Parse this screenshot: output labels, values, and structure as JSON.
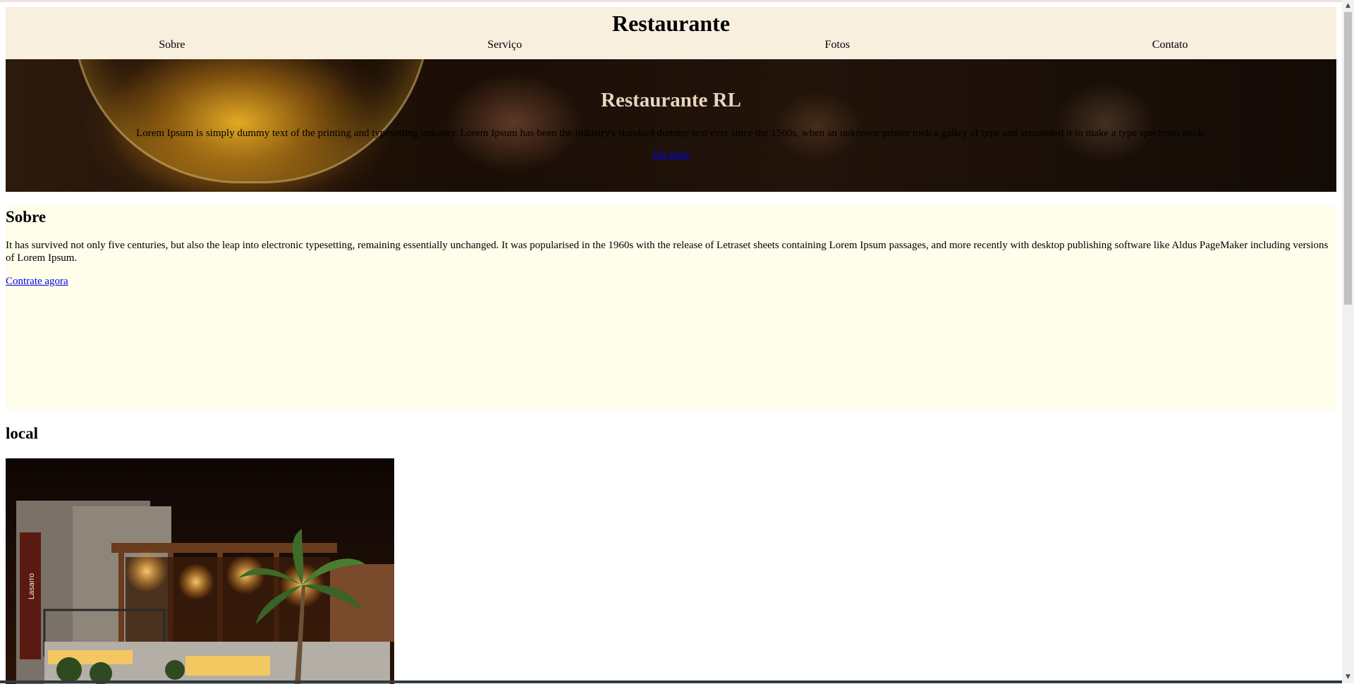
{
  "header": {
    "title": "Restaurante"
  },
  "nav": {
    "items": [
      "Sobre",
      "Serviço",
      "Fotos",
      "Contato"
    ]
  },
  "hero": {
    "title": "Restaurante RL",
    "text": "Lorem Ipsum is simply dummy text of the printing and typesetting industry. Lorem Ipsum has been the industry's standard dummy text ever since the 1500s, when an unknown printer took a galley of type and scrambled it to make a type specimen book.",
    "link_label": "Ver mais"
  },
  "sobre": {
    "title": "Sobre",
    "text": "It has survived not only five centuries, but also the leap into electronic typesetting, remaining essentially unchanged. It was popularised in the 1960s with the release of Letraset sheets containing Lorem Ipsum passages, and more recently with desktop publishing software like Aldus PageMaker including versions of Lorem Ipsum.",
    "link_label": "Contrate agora"
  },
  "local": {
    "title": "local",
    "sign_text": "Lasarro"
  },
  "scrollbar": {
    "up_icon": "arrow-up-icon",
    "down_icon": "arrow-down-icon"
  }
}
